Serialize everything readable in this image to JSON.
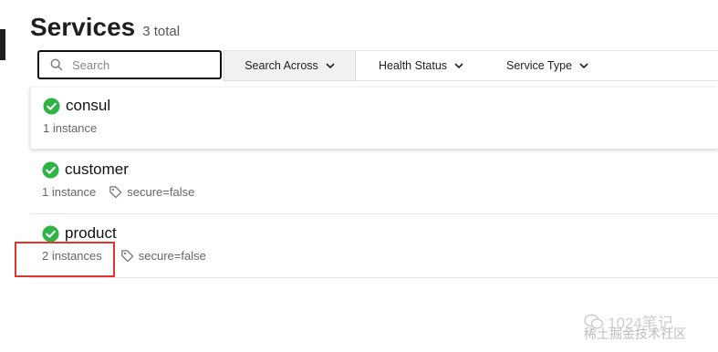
{
  "page": {
    "title": "Services",
    "count_label": "3 total"
  },
  "toolbar": {
    "search_placeholder": "Search",
    "search_value": "",
    "search_across_label": "Search Across",
    "health_status_label": "Health Status",
    "service_type_label": "Service Type"
  },
  "services": [
    {
      "name": "consul",
      "instances": "1 instance",
      "tag": "",
      "status": "passing"
    },
    {
      "name": "customer",
      "instances": "1 instance",
      "tag": "secure=false",
      "status": "passing"
    },
    {
      "name": "product",
      "instances": "2 instances",
      "tag": "secure=false",
      "status": "passing"
    }
  ],
  "watermark": {
    "line1": "1024笔记",
    "line2": "稀土掘金技术社区"
  },
  "colors": {
    "passing": "#2fb344",
    "highlight": "#e0352b"
  }
}
